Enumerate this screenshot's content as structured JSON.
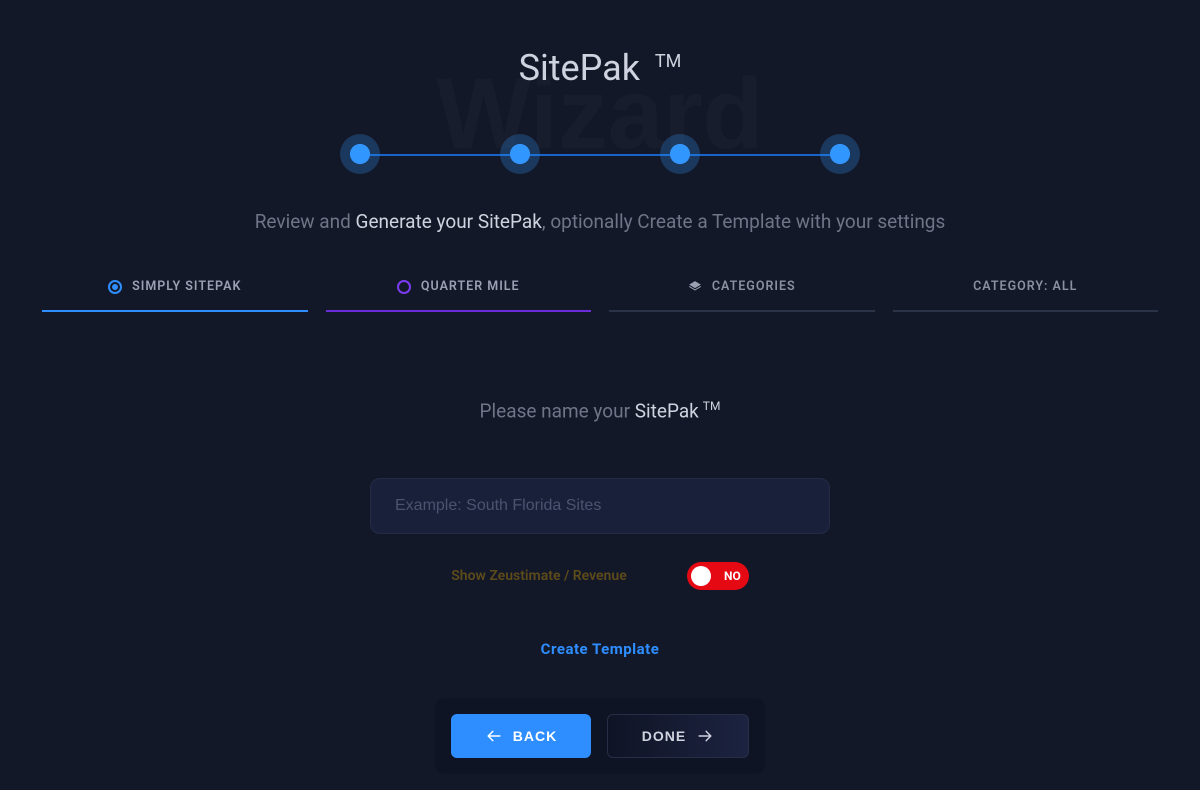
{
  "bg_word": "Wizard",
  "title": {
    "text": "SitePak",
    "tm": "TM"
  },
  "stepper": {
    "steps": 4,
    "active": 4
  },
  "subtitle": {
    "pre": "Review and ",
    "strong": "Generate your SitePak",
    "post": ", optionally Create a Template with your settings"
  },
  "tabs": [
    {
      "key": "simply",
      "label": "SIMPLY SITEPAK",
      "icon": "radio-filled",
      "style": "blue"
    },
    {
      "key": "quarter",
      "label": "QUARTER MILE",
      "icon": "radio-empty",
      "style": "purple"
    },
    {
      "key": "categories",
      "label": "CATEGORIES",
      "icon": "diamond",
      "style": "plain"
    },
    {
      "key": "catall",
      "label": "CATEGORY: ALL",
      "icon": "none",
      "style": "plain"
    }
  ],
  "form": {
    "prompt_pre": "Please name your ",
    "prompt_strong": "SitePak",
    "prompt_tm": "TM",
    "input_placeholder": "Example: South Florida Sites",
    "input_value": "",
    "zeustimate_label": "Show Zeustimate / Revenue",
    "zeustimate_state": "NO",
    "create_template": "Create Template"
  },
  "buttons": {
    "back": "BACK",
    "done": "DONE"
  }
}
